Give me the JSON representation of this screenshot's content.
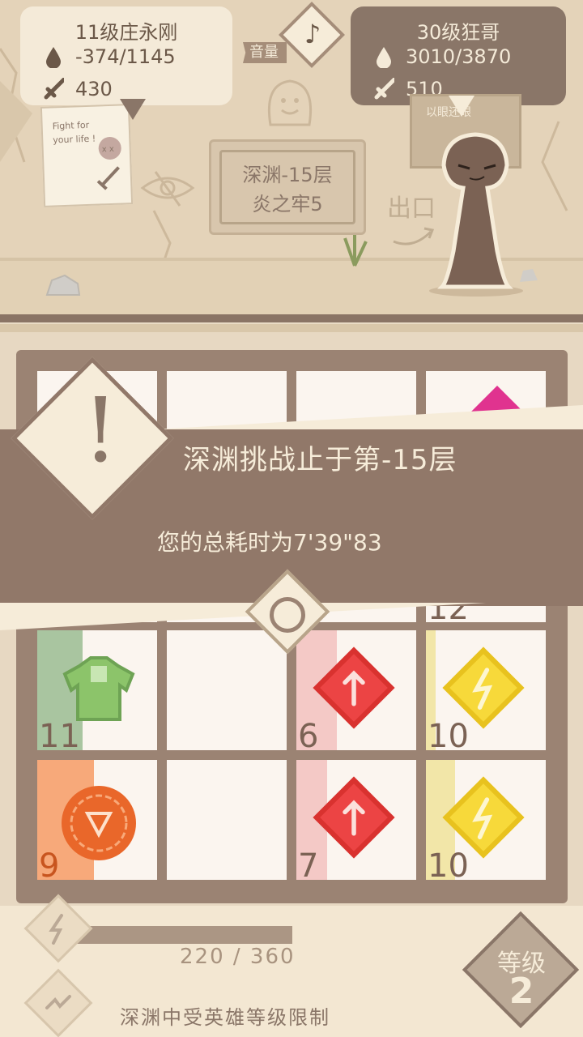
{
  "player": {
    "name": "11级庄永刚",
    "hp": "-374/1145",
    "attack": "430"
  },
  "enemy": {
    "name": "30级狂哥",
    "hp": "3010/3870",
    "attack": "510",
    "board_text": "以眼还眼"
  },
  "volume_label": "音量",
  "note_paper": {
    "text": "Fight for your life !"
  },
  "sign": {
    "line1": "深渊-15层",
    "line2": "炎之牢5"
  },
  "exit_label": "出口",
  "banner": {
    "title": "深渊挑战止于第-15层",
    "subtitle": "您的总耗时为7'39\"83"
  },
  "cells": [
    {
      "row": 2,
      "col": 0,
      "number": "11",
      "item": "armor",
      "stripe_color": "#a9c5a0"
    },
    {
      "row": 2,
      "col": 1,
      "number": "",
      "item": "none",
      "stripe_color": ""
    },
    {
      "row": 2,
      "col": 2,
      "number": "6",
      "item": "attack-gem",
      "stripe_color": "#f4c9c6"
    },
    {
      "row": 2,
      "col": 3,
      "number": "10",
      "item": "energy-gem",
      "stripe_color": "#f2e6a8"
    },
    {
      "row": 3,
      "col": 0,
      "number": "9",
      "item": "coin",
      "stripe_color": "#f7a97a"
    },
    {
      "row": 3,
      "col": 1,
      "number": "",
      "item": "none",
      "stripe_color": ""
    },
    {
      "row": 3,
      "col": 2,
      "number": "7",
      "item": "attack-gem",
      "stripe_color": "#f4c9c6"
    },
    {
      "row": 3,
      "col": 3,
      "number": "10",
      "item": "energy-gem",
      "stripe_color": "#f2e6a8"
    }
  ],
  "partial_number": "12",
  "energy": {
    "text": "220 / 360",
    "fraction": 0.61
  },
  "limit_text": "深渊中受英雄等级限制",
  "level": {
    "label": "等级",
    "value": "2"
  }
}
